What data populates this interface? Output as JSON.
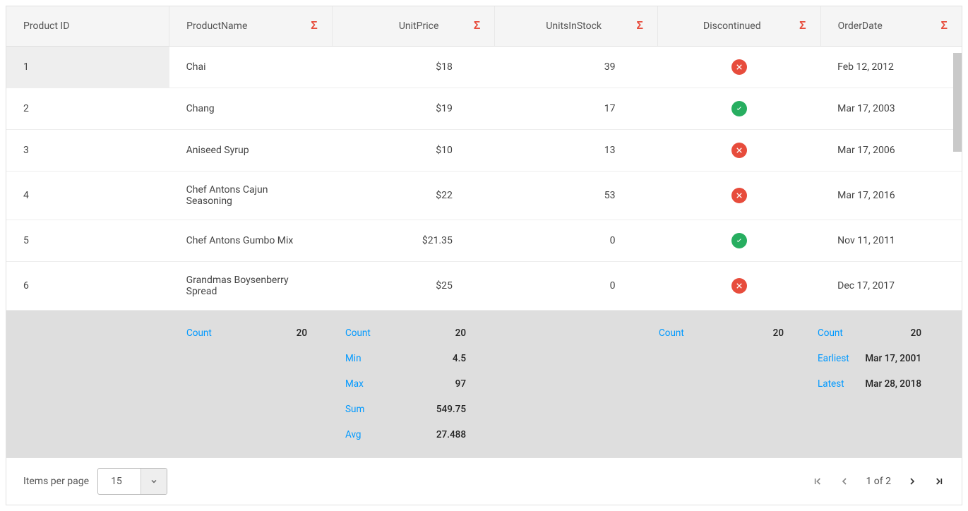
{
  "columns": {
    "product_id": "Product ID",
    "product_name": "ProductName",
    "unit_price": "UnitPrice",
    "units_in_stock": "UnitsInStock",
    "discontinued": "Discontinued",
    "order_date": "OrderDate"
  },
  "sigma": "Σ",
  "rows": [
    {
      "id": "1",
      "name": "Chai",
      "price": "$18",
      "stock": "39",
      "discontinued": false,
      "date": "Feb 12, 2012"
    },
    {
      "id": "2",
      "name": "Chang",
      "price": "$19",
      "stock": "17",
      "discontinued": true,
      "date": "Mar 17, 2003"
    },
    {
      "id": "3",
      "name": "Aniseed Syrup",
      "price": "$10",
      "stock": "13",
      "discontinued": false,
      "date": "Mar 17, 2006"
    },
    {
      "id": "4",
      "name": "Chef Antons Cajun Seasoning",
      "price": "$22",
      "stock": "53",
      "discontinued": false,
      "date": "Mar 17, 2016"
    },
    {
      "id": "5",
      "name": "Chef Antons Gumbo Mix",
      "price": "$21.35",
      "stock": "0",
      "discontinued": true,
      "date": "Nov 11, 2011"
    },
    {
      "id": "6",
      "name": "Grandmas Boysenberry Spread",
      "price": "$25",
      "stock": "0",
      "discontinued": false,
      "date": "Dec 17, 2017"
    }
  ],
  "summary": {
    "name": {
      "count_label": "Count",
      "count": "20"
    },
    "price": {
      "count_label": "Count",
      "count": "20",
      "min_label": "Min",
      "min": "4.5",
      "max_label": "Max",
      "max": "97",
      "sum_label": "Sum",
      "sum": "549.75",
      "avg_label": "Avg",
      "avg": "27.488"
    },
    "disc": {
      "count_label": "Count",
      "count": "20"
    },
    "date": {
      "count_label": "Count",
      "count": "20",
      "earliest_label": "Earliest",
      "earliest": "Mar 17, 2001",
      "latest_label": "Latest",
      "latest": "Mar 28, 2018"
    }
  },
  "footer": {
    "per_page_label": "Items per page",
    "per_page_value": "15",
    "pager_info": "1 of 2"
  }
}
